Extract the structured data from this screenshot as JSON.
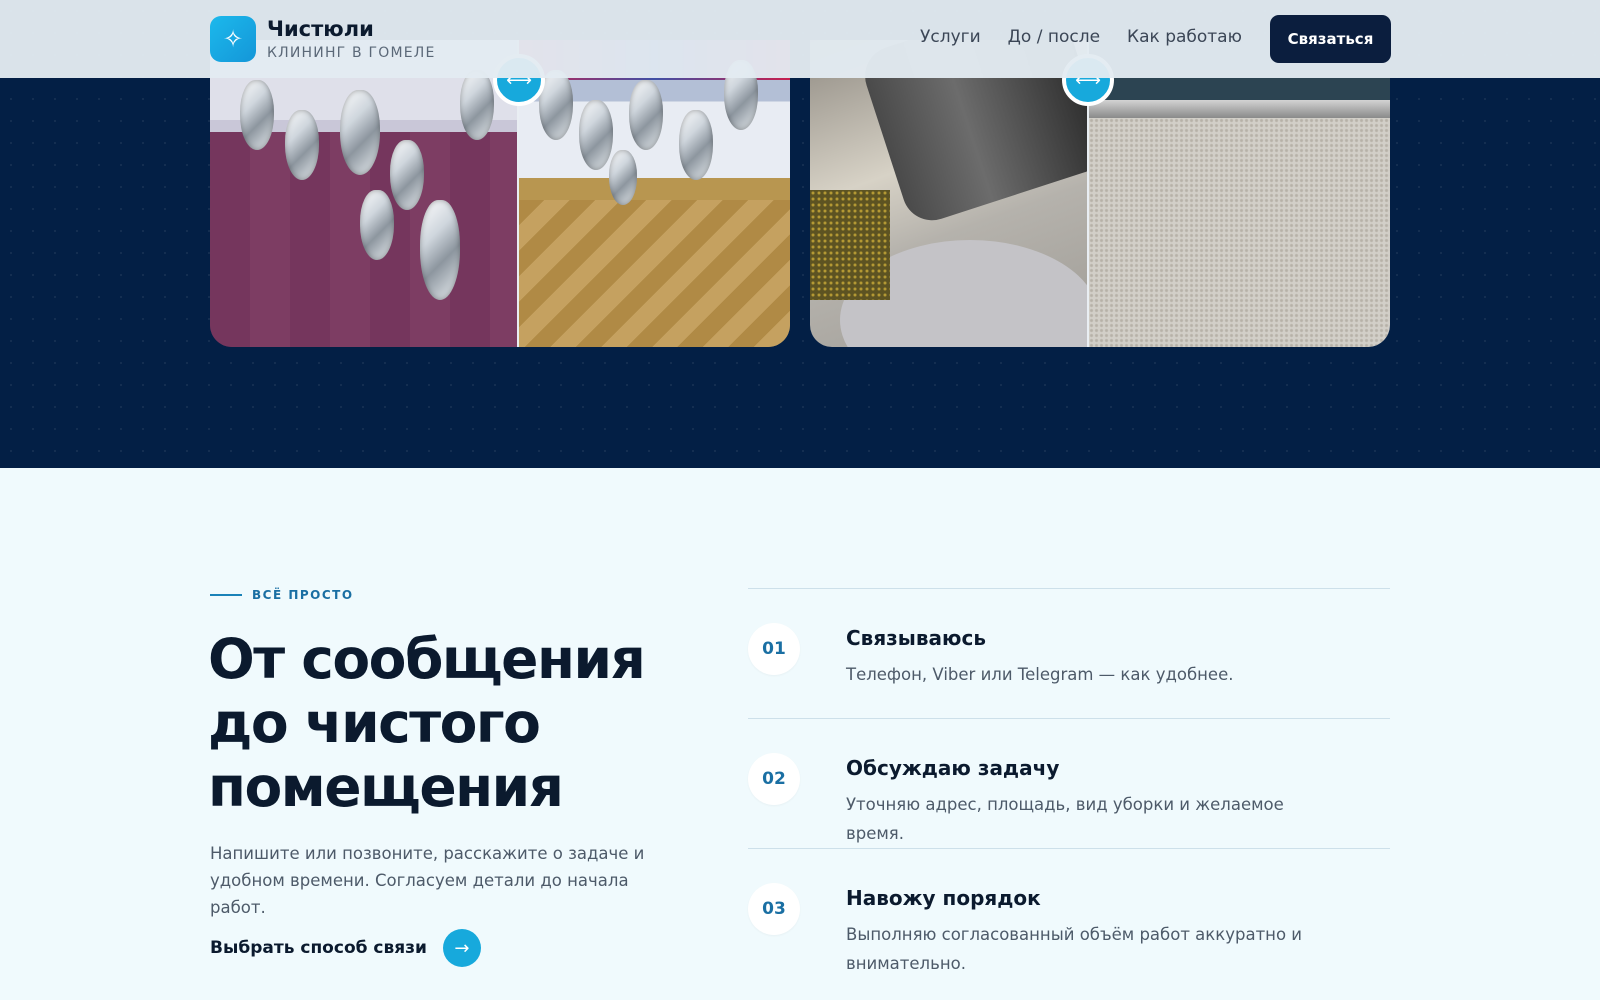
{
  "header": {
    "brand_name": "Чистюли",
    "brand_sub": "КЛИНИНГ В ГОМЕЛЕ",
    "logo_icon": "sparkle-icon",
    "nav": [
      "Услуги",
      "До / после",
      "Как работаю"
    ],
    "cta_label": "Связаться"
  },
  "gallery": {
    "handle_icon": "drag-arrows-icon",
    "cards": [
      {
        "subject": "chandelier"
      },
      {
        "subject": "carpet"
      }
    ]
  },
  "steps_section": {
    "eyebrow": "ВСЁ ПРОСТО",
    "headline": "От сообщения до чистого помещения",
    "lead": "Напишите или позвоните, расскажите о задаче и удобном времени. Согласуем детали до начала работ.",
    "choose_label": "Выбрать способ связи",
    "arrow_glyph": "→",
    "steps": [
      {
        "num": "01",
        "title": "Связываюсь",
        "text": "Телефон, Viber или Telegram — как удобнее."
      },
      {
        "num": "02",
        "title": "Обсуждаю задачу",
        "text": "Уточняю адрес, площадь, вид уборки и желаемое время."
      },
      {
        "num": "03",
        "title": "Навожу порядок",
        "text": "Выполняю согласованный объём работ аккуратно и внимательно."
      }
    ]
  },
  "colors": {
    "accent": "#17a9dc",
    "navy": "#031f45",
    "button": "#0b1e3e",
    "section_bg": "#f0fafd"
  }
}
